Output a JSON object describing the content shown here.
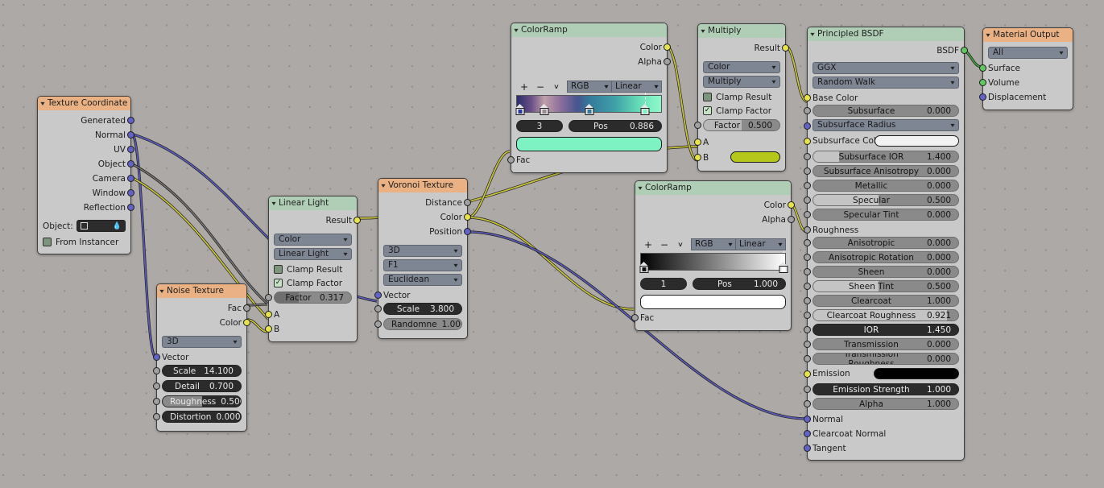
{
  "app": {
    "editor": "Blender Shader Node Editor",
    "background": "#ada9a7"
  },
  "colors": {
    "header_texture": "#e9b184",
    "header_converter": "#b0ceb6",
    "node_body": "#c9c9c9",
    "socket_color": "#e7e34d",
    "socket_vector": "#6363c7",
    "socket_shader": "#62c762",
    "socket_value": "#a1a1a1",
    "wire_color": "#c8c43f",
    "wire_vector": "#5b5bb5",
    "wire_shader": "#3f9f3f",
    "wire_value": "#7a7a7a"
  },
  "nodes": {
    "texture_coordinate": {
      "title": "Texture Coordinate",
      "outputs": [
        "Generated",
        "Normal",
        "UV",
        "Object",
        "Camera",
        "Window",
        "Reflection"
      ],
      "object_label": "Object:",
      "object_value": "",
      "from_instancer_label": "From Instancer",
      "from_instancer_checked": false
    },
    "noise_texture": {
      "title": "Noise Texture",
      "outputs": [
        "Fac",
        "Color"
      ],
      "dimension": "3D",
      "vector_label": "Vector",
      "params": [
        {
          "label": "Scale",
          "value": "14.100",
          "fill": 0.0
        },
        {
          "label": "Detail",
          "value": "0.700",
          "fill": 0.0
        },
        {
          "label": "Roughness",
          "value": "0.500",
          "fill": 0.5
        },
        {
          "label": "Distortion",
          "value": "0.000",
          "fill": 0.0
        }
      ]
    },
    "linear_light": {
      "title": "Linear Light",
      "outputs": [
        "Result"
      ],
      "data_type": "Color",
      "blend_mode": "Linear Light",
      "clamp_result_label": "Clamp Result",
      "clamp_result_checked": false,
      "clamp_factor_label": "Clamp Factor",
      "clamp_factor_checked": true,
      "factor_label": "Factor",
      "factor_value": "0.317",
      "inputs": [
        "A",
        "B"
      ]
    },
    "voronoi_texture": {
      "title": "Voronoi Texture",
      "outputs": [
        "Distance",
        "Color",
        "Position"
      ],
      "dimension": "3D",
      "feature": "F1",
      "metric": "Euclidean",
      "vector_label": "Vector",
      "params": [
        {
          "label": "Scale",
          "value": "3.800",
          "fill": 0.0
        },
        {
          "label": "Randomne",
          "value": "1.000",
          "fill": 0.0
        }
      ]
    },
    "colorramp_1": {
      "title": "ColorRamp",
      "outputs": [
        "Color",
        "Alpha"
      ],
      "tools": {
        "add": "+",
        "remove": "−",
        "menu": "∨"
      },
      "color_mode": "RGB",
      "interpolation": "Linear",
      "stops": [
        {
          "pos": 0.02,
          "color": "#2a2d6b"
        },
        {
          "pos": 0.19,
          "color": "#c0a0a8"
        },
        {
          "pos": 0.5,
          "color": "#35799a"
        },
        {
          "pos": 0.886,
          "color": "#7df0c2"
        }
      ],
      "active_index": "3",
      "pos_label": "Pos",
      "pos_value": "0.886",
      "active_color": "#7ff2c4",
      "fac_label": "Fac"
    },
    "colorramp_2": {
      "title": "ColorRamp",
      "outputs": [
        "Color",
        "Alpha"
      ],
      "tools": {
        "add": "+",
        "remove": "−",
        "menu": "∨"
      },
      "color_mode": "RGB",
      "interpolation": "Linear",
      "stops": [
        {
          "pos": 0.01,
          "color": "#000000"
        },
        {
          "pos": 1.0,
          "color": "#ffffff"
        }
      ],
      "active_index": "1",
      "pos_label": "Pos",
      "pos_value": "1.000",
      "active_color": "#ffffff",
      "fac_label": "Fac"
    },
    "multiply": {
      "title": "Multiply",
      "outputs": [
        "Result"
      ],
      "data_type": "Color",
      "blend_mode": "Multiply",
      "clamp_result_label": "Clamp Result",
      "clamp_result_checked": false,
      "clamp_factor_label": "Clamp Factor",
      "clamp_factor_checked": true,
      "factor_label": "Factor",
      "factor_value": "0.500",
      "inputs": [
        "A",
        "B"
      ],
      "b_color": "#b5c71b"
    },
    "principled_bsdf": {
      "title": "Principled BSDF",
      "output_label": "BSDF",
      "distribution": "GGX",
      "subsurface_method": "Random Walk",
      "base_color_label": "Base Color",
      "subsurface_color_label": "Subsurface Color",
      "subsurface_color": "#f2f2f2",
      "subsurface_radius_label": "Subsurface Radius",
      "roughness_label": "Roughness",
      "emission_label": "Emission",
      "emission_color": "#000000",
      "normal_label": "Normal",
      "clearcoat_normal_label": "Clearcoat Normal",
      "tangent_label": "Tangent",
      "params": [
        {
          "label": "Subsurface",
          "value": "0.000",
          "fill": 0.0
        },
        {
          "label": "Subsurface IOR",
          "value": "1.400",
          "fill": 0.18
        },
        {
          "label": "Subsurface Anisotropy",
          "value": "0.000",
          "fill": 0.0
        },
        {
          "label": "Metallic",
          "value": "0.000",
          "fill": 0.0
        },
        {
          "label": "Specular",
          "value": "0.500",
          "fill": 0.45
        },
        {
          "label": "Specular Tint",
          "value": "0.000",
          "fill": 0.0
        },
        {
          "label": "Anisotropic",
          "value": "0.000",
          "fill": 0.0
        },
        {
          "label": "Anisotropic Rotation",
          "value": "0.000",
          "fill": 0.0
        },
        {
          "label": "Sheen",
          "value": "0.000",
          "fill": 0.0
        },
        {
          "label": "Sheen Tint",
          "value": "0.500",
          "fill": 0.45
        },
        {
          "label": "Clearcoat",
          "value": "1.000",
          "fill": 0.0
        },
        {
          "label": "Clearcoat Roughness",
          "value": "0.921",
          "fill": 0.92
        },
        {
          "label": "IOR",
          "value": "1.450",
          "fill": 0.0
        },
        {
          "label": "Transmission",
          "value": "0.000",
          "fill": 0.0
        },
        {
          "label": "Transmission Roughness",
          "value": "0.000",
          "fill": 0.0
        },
        {
          "label": "Emission Strength",
          "value": "1.000",
          "fill": 0.0
        },
        {
          "label": "Alpha",
          "value": "1.000",
          "fill": 0.0
        }
      ]
    },
    "material_output": {
      "title": "Material Output",
      "target": "All",
      "inputs": [
        "Surface",
        "Volume",
        "Displacement"
      ]
    }
  }
}
